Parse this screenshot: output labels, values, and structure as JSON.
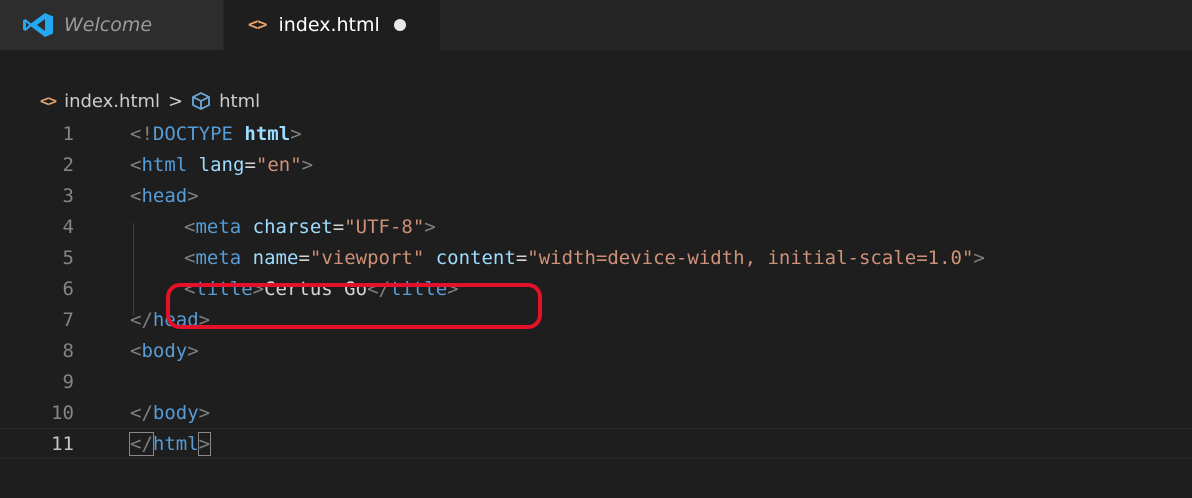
{
  "tabs": {
    "welcome_label": "Welcome",
    "index_label": "index.html",
    "index_glyph": "<>",
    "index_dirty": true
  },
  "breadcrumb": {
    "file_glyph": "<>",
    "file": "index.html",
    "separator": ">",
    "symbol": "html"
  },
  "colors": {
    "accent_highlight": "#e3112a",
    "vscode_blue": "#23a9f2",
    "tag_blue": "#569cd6",
    "attr_blue": "#9cdcfe",
    "string_orange": "#ce9178"
  },
  "editor": {
    "lines": [
      {
        "n": "1",
        "doc_open": "<!",
        "doc_kw": "DOCTYPE",
        "doc_name": "html",
        "doc_close": ">"
      },
      {
        "n": "2",
        "open": "<",
        "tag": "html",
        "attr": "lang",
        "eq": "=",
        "val": "\"en\"",
        "close": ">"
      },
      {
        "n": "3",
        "open": "<",
        "tag": "head",
        "close": ">"
      },
      {
        "n": "4",
        "open": "<",
        "tag": "meta",
        "attr": "charset",
        "eq": "=",
        "val": "\"UTF-8\"",
        "close": ">"
      },
      {
        "n": "5",
        "open": "<",
        "tag": "meta",
        "attr1": "name",
        "eq1": "=",
        "val1": "\"viewport\"",
        "attr2": "content",
        "eq2": "=",
        "val2": "\"width=device-width, initial-scale=1.0\"",
        "close": ">"
      },
      {
        "n": "6",
        "open": "<",
        "tag": "title",
        "close": ">",
        "text": "Certus Go",
        "end_open": "</",
        "end_tag": "title",
        "end_close": ">"
      },
      {
        "n": "7",
        "open": "</",
        "tag": "head",
        "close": ">"
      },
      {
        "n": "8",
        "open": "<",
        "tag": "body",
        "close": ">"
      },
      {
        "n": "9"
      },
      {
        "n": "10",
        "open": "</",
        "tag": "body",
        "close": ">"
      },
      {
        "n": "11",
        "open": "</",
        "tag": "html",
        "close": ">"
      }
    ]
  }
}
